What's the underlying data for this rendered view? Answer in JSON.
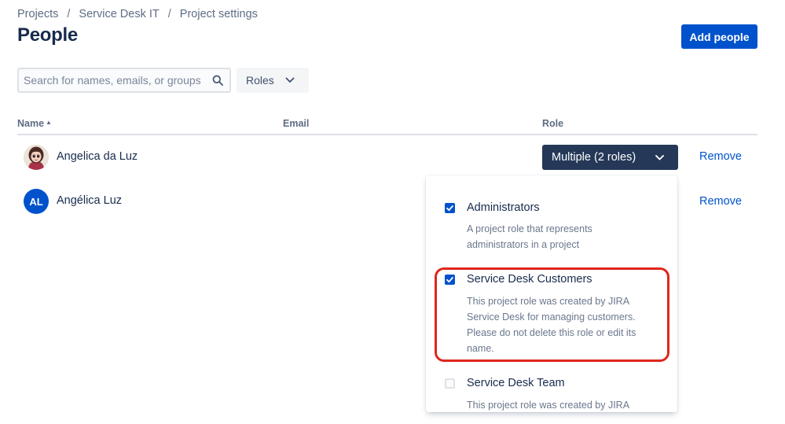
{
  "breadcrumb": [
    "Projects",
    "Service Desk IT",
    "Project settings"
  ],
  "breadcrumb_separator": "/",
  "page_title": "People",
  "add_people_label": "Add people",
  "search": {
    "placeholder": "Search for names, emails, or groups",
    "value": ""
  },
  "roles_filter_label": "Roles",
  "table": {
    "headers": {
      "name": "Name",
      "name_sort_icon": "sort-ascending-icon",
      "email": "Email",
      "role": "Role"
    },
    "rows": [
      {
        "name": "Angelica da Luz",
        "avatar": "photo",
        "email": "",
        "role": "Multiple (2 roles)",
        "action": "Remove"
      },
      {
        "name": "Angélica Luz",
        "avatar_initials": "AL",
        "email": "",
        "role": "",
        "action": "Remove"
      }
    ]
  },
  "role_dropdown": {
    "options": [
      {
        "label": "Administrators",
        "checked": true,
        "description": "A project role that represents administrators in a project"
      },
      {
        "label": "Service Desk Customers",
        "checked": true,
        "highlighted": true,
        "description": "This project role was created by JIRA Service Desk for managing customers. Please do not delete this role or edit its name."
      },
      {
        "label": "Service Desk Team",
        "checked": false,
        "description": "This project role was created by JIRA"
      }
    ]
  },
  "colors": {
    "primary": "#0052cc",
    "role_select_bg": "#253858",
    "highlight": "#e0261a",
    "text": "#172b4d",
    "subtle_text": "#6b778c"
  }
}
